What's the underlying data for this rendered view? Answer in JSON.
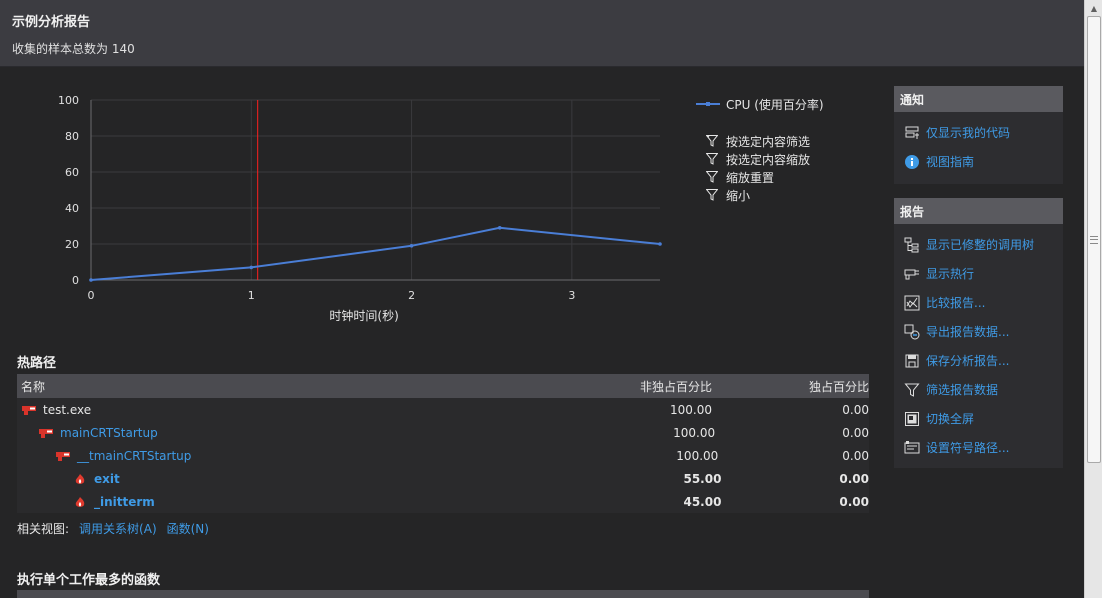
{
  "header": {
    "title": "示例分析报告",
    "subtitle": "收集的样本总数为 140"
  },
  "chart_data": {
    "type": "line",
    "x": [
      0,
      1.0,
      2.0,
      2.55,
      3.55
    ],
    "series": [
      {
        "name": "CPU (使用百分率)",
        "values": [
          0,
          7,
          19,
          29,
          20
        ],
        "color": "#4a7ed6"
      }
    ],
    "xlabel": "时钟时间(秒)",
    "ylabel": "",
    "xlim": [
      0,
      3.55
    ],
    "ylim": [
      0,
      100
    ],
    "x_ticks": [
      0,
      1,
      2,
      3
    ],
    "y_ticks": [
      0,
      20,
      40,
      60,
      80,
      100
    ],
    "marker_line_x": 1.04,
    "marker_line_color": "#ff2020",
    "grid": true,
    "legend_placement": "right"
  },
  "chart_actions": [
    {
      "label": "按选定内容筛选",
      "icon": "filter-selection-icon"
    },
    {
      "label": "按选定内容缩放",
      "icon": "filter-icon"
    },
    {
      "label": "缩放重置",
      "icon": "filter-icon"
    },
    {
      "label": "缩小",
      "icon": "filter-icon"
    }
  ],
  "hot_path": {
    "title": "热路径",
    "columns": [
      "名称",
      "非独占百分比",
      "独占百分比"
    ],
    "rows": [
      {
        "name": "test.exe",
        "inclusive": "100.00",
        "exclusive": "0.00",
        "level": 0,
        "link": false,
        "bold": false,
        "icon": "hot-path-icon"
      },
      {
        "name": "mainCRTStartup",
        "inclusive": "100.00",
        "exclusive": "0.00",
        "level": 1,
        "link": true,
        "bold": false,
        "icon": "hot-path-icon"
      },
      {
        "name": "__tmainCRTStartup",
        "inclusive": "100.00",
        "exclusive": "0.00",
        "level": 2,
        "link": true,
        "bold": false,
        "icon": "hot-path-icon"
      },
      {
        "name": "exit",
        "inclusive": "55.00",
        "exclusive": "0.00",
        "level": 3,
        "link": true,
        "bold": true,
        "icon": "flame-icon"
      },
      {
        "name": "_initterm",
        "inclusive": "45.00",
        "exclusive": "0.00",
        "level": 3,
        "link": true,
        "bold": true,
        "icon": "flame-icon"
      }
    ],
    "related_label": "相关视图:",
    "related_links": [
      "调用关系树(A)",
      "函数(N)"
    ]
  },
  "functions_section": {
    "title": "执行单个工作最多的函数"
  },
  "notifications": {
    "title": "通知",
    "items": [
      {
        "label": "仅显示我的代码",
        "icon": "just-my-code-icon"
      },
      {
        "label": "视图指南",
        "icon": "info-icon"
      }
    ]
  },
  "reports": {
    "title": "报告",
    "items": [
      {
        "label": "显示已修整的调用树",
        "icon": "call-tree-icon"
      },
      {
        "label": "显示热行",
        "icon": "hot-lines-icon"
      },
      {
        "label": "比较报告...",
        "icon": "compare-icon"
      },
      {
        "label": "导出报告数据...",
        "icon": "export-icon"
      },
      {
        "label": "保存分析报告...",
        "icon": "save-icon"
      },
      {
        "label": "筛选报告数据",
        "icon": "filter-icon"
      },
      {
        "label": "切换全屏",
        "icon": "fullscreen-icon"
      },
      {
        "label": "设置符号路径...",
        "icon": "symbol-path-icon"
      }
    ]
  }
}
